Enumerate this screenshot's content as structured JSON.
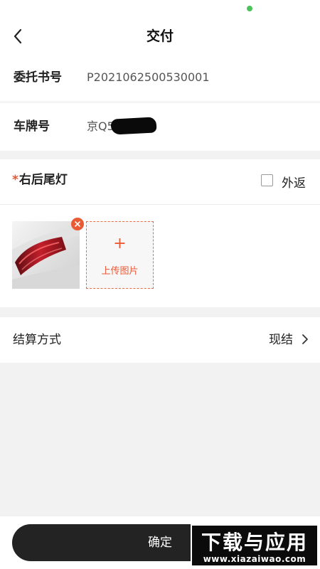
{
  "nav": {
    "title": "交付",
    "back_icon": "chevron-left-icon"
  },
  "order": {
    "entrust_label": "委托书号",
    "entrust_value": "P2021062500530001",
    "plate_label": "车牌号",
    "plate_value": "京Q5"
  },
  "part": {
    "required_mark": "*",
    "name": "右后尾灯",
    "return_label": "外返",
    "return_checked": false,
    "photos_count": 1,
    "remove_icon": "close-icon",
    "upload_plus": "+",
    "upload_label": "上传图片"
  },
  "settlement": {
    "label": "结算方式",
    "value": "现结",
    "arrow_icon": "chevron-right-icon"
  },
  "footer": {
    "confirm_label": "确定"
  },
  "watermark": {
    "text": "下载与应用",
    "url": "www.xiazaiwao.com"
  },
  "colors": {
    "accent": "#ea5a35",
    "button_bg": "#232323",
    "status_dot": "#4cc35a"
  }
}
